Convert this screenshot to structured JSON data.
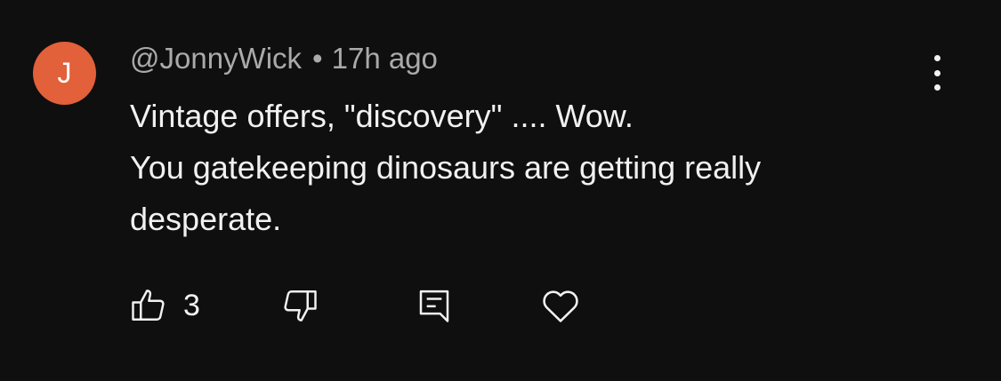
{
  "comment": {
    "avatar_letter": "J",
    "avatar_color": "#e2603a",
    "author": "@JonnyWick",
    "separator": "•",
    "time": "17h ago",
    "lines": [
      "Vintage offers, \"discovery\" .... Wow.",
      "You gatekeeping dinosaurs are getting really",
      "desperate."
    ],
    "like_count": "3"
  },
  "icons": {
    "like": "thumbs-up-icon",
    "dislike": "thumbs-down-icon",
    "reply": "reply-comment-icon",
    "heart": "heart-icon",
    "more": "more-vertical-icon"
  }
}
